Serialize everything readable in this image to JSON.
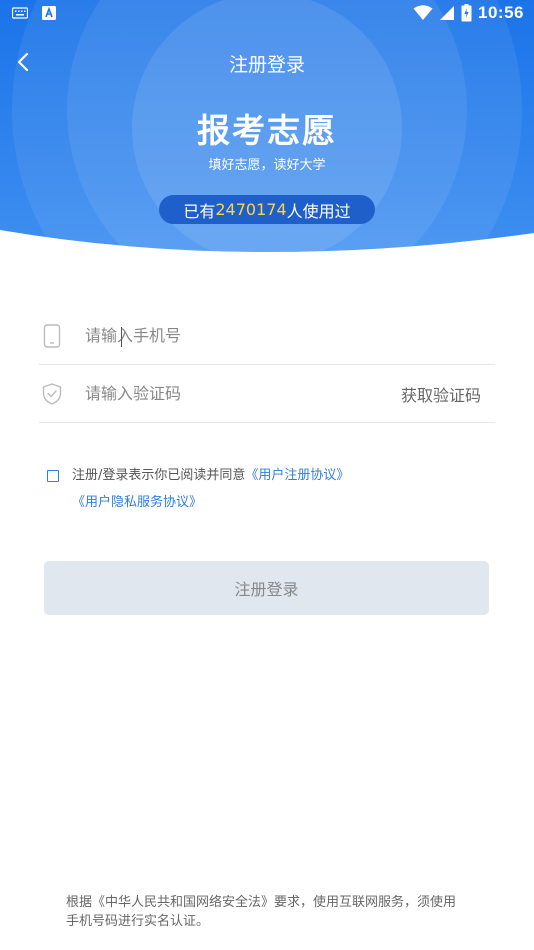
{
  "colors": {
    "header_gradient_top": "#1a73e8",
    "header_gradient_bottom": "#4a9af3",
    "accent": "#2f7de1",
    "highlight": "#ffd24a",
    "button_disabled_bg": "#e1e7ef"
  },
  "status_bar": {
    "left_icons": [
      "keyboard-icon",
      "app-a-icon"
    ],
    "right_icons": [
      "wifi-icon",
      "signal-icon",
      "battery-icon"
    ],
    "time": "10:56"
  },
  "nav": {
    "back_icon": "chevron-left-icon",
    "title": "注册登录"
  },
  "brand": {
    "title": "报考志愿",
    "subtitle": "填好志愿，读好大学"
  },
  "usage": {
    "prefix": "已有",
    "count": "2470174",
    "suffix": "人使用过"
  },
  "form": {
    "phone": {
      "icon": "phone-icon",
      "placeholder": "请输入手机号",
      "value": ""
    },
    "code": {
      "icon": "shield-check-icon",
      "placeholder": "请输入验证码",
      "value": "",
      "get_code_label": "获取验证码"
    }
  },
  "agreement": {
    "checked": false,
    "text": "注册/登录表示你已阅读并同意",
    "link_user": "《用户注册协议》",
    "link_privacy": "《用户隐私服务协议》"
  },
  "submit": {
    "label": "注册登录",
    "enabled": false
  },
  "footer": {
    "notice": "根据《中华人民共和国网络安全法》要求，使用互联网服务，须使用手机号码进行实名认证。"
  }
}
